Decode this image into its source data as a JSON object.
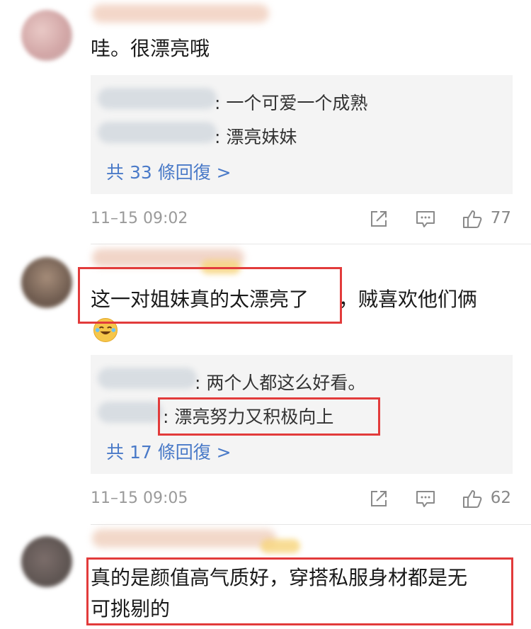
{
  "comments": [
    {
      "text": "哇。很漂亮哦",
      "replies": [
        {
          "text": ": 一个可爱一个成熟"
        },
        {
          "text": ": 漂亮妹妹"
        }
      ],
      "more_label": "共 33 條回復 >",
      "time": "11–15 09:02",
      "likes": "77"
    },
    {
      "text_highlight": "这一对姐妹真的太漂亮了",
      "text_rest": "，贼喜欢他们俩",
      "replies": [
        {
          "text": ": 两个人都这么好看。"
        },
        {
          "text": ": 漂亮努力又积极向上"
        }
      ],
      "more_label": "共 17 條回復 >",
      "time": "11–15 09:05",
      "likes": "62"
    },
    {
      "line1": "真的是颜值高气质好，穿搭私服身材都是无",
      "line2": "可挑剔的"
    }
  ],
  "icons": {
    "share": "share-icon",
    "comment": "comment-icon",
    "like": "thumbs-up-icon",
    "emoji": "laughing-tears-emoji"
  },
  "colors": {
    "highlight_box": "#e23b3b",
    "link": "#4a7ac8",
    "reply_bg": "#f4f4f4"
  }
}
